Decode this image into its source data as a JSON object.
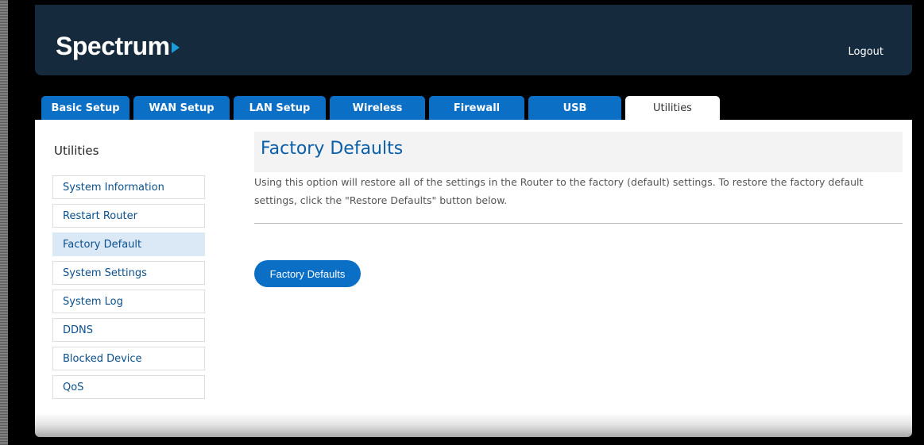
{
  "header": {
    "logo_text": "Spectrum",
    "logout_label": "Logout"
  },
  "tabs": [
    {
      "label": "Basic Setup",
      "active": false
    },
    {
      "label": "WAN Setup",
      "active": false
    },
    {
      "label": "LAN Setup",
      "active": false
    },
    {
      "label": "Wireless",
      "active": false
    },
    {
      "label": "Firewall",
      "active": false
    },
    {
      "label": "USB",
      "active": false
    },
    {
      "label": "Utilities",
      "active": true
    }
  ],
  "sidebar": {
    "title": "Utilities",
    "items": [
      {
        "label": "System Information",
        "active": false
      },
      {
        "label": "Restart Router",
        "active": false
      },
      {
        "label": "Factory Default",
        "active": true
      },
      {
        "label": "System Settings",
        "active": false
      },
      {
        "label": "System Log",
        "active": false
      },
      {
        "label": "DDNS",
        "active": false
      },
      {
        "label": "Blocked Device",
        "active": false
      },
      {
        "label": "QoS",
        "active": false
      }
    ]
  },
  "main": {
    "title": "Factory Defaults",
    "description": "Using this option will restore all of the settings in the Router to the factory (default) settings. To restore the factory default settings, click the \"Restore Defaults\" button below.",
    "button_label": "Factory Defaults"
  },
  "colors": {
    "header_bg": "#152a3d",
    "accent": "#0b6fc6",
    "logo_arrow": "#1b9bd7",
    "active_sidebar_bg": "#dbe9f6"
  }
}
